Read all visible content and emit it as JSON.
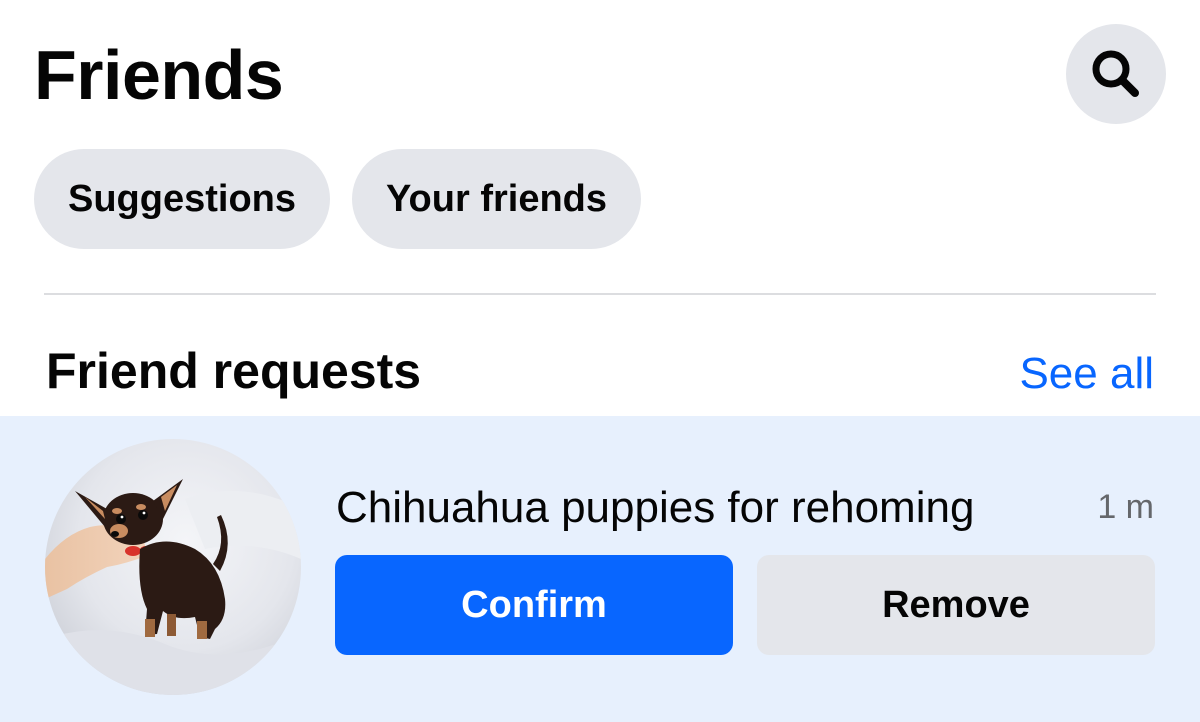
{
  "header": {
    "title": "Friends",
    "search_icon": "search-icon"
  },
  "chips": [
    {
      "label": "Suggestions"
    },
    {
      "label": "Your friends"
    }
  ],
  "friend_requests": {
    "title": "Friend requests",
    "see_all_label": "See all",
    "items": [
      {
        "name": "Chihuahua puppies for rehoming",
        "time": "1 m",
        "avatar": "chihuahua-puppy-photo",
        "confirm_label": "Confirm",
        "remove_label": "Remove"
      }
    ]
  },
  "colors": {
    "accent": "#0866ff",
    "chip_bg": "#e4e6eb",
    "highlight_row_bg": "#e7f0fd",
    "secondary_text": "#65676b"
  }
}
